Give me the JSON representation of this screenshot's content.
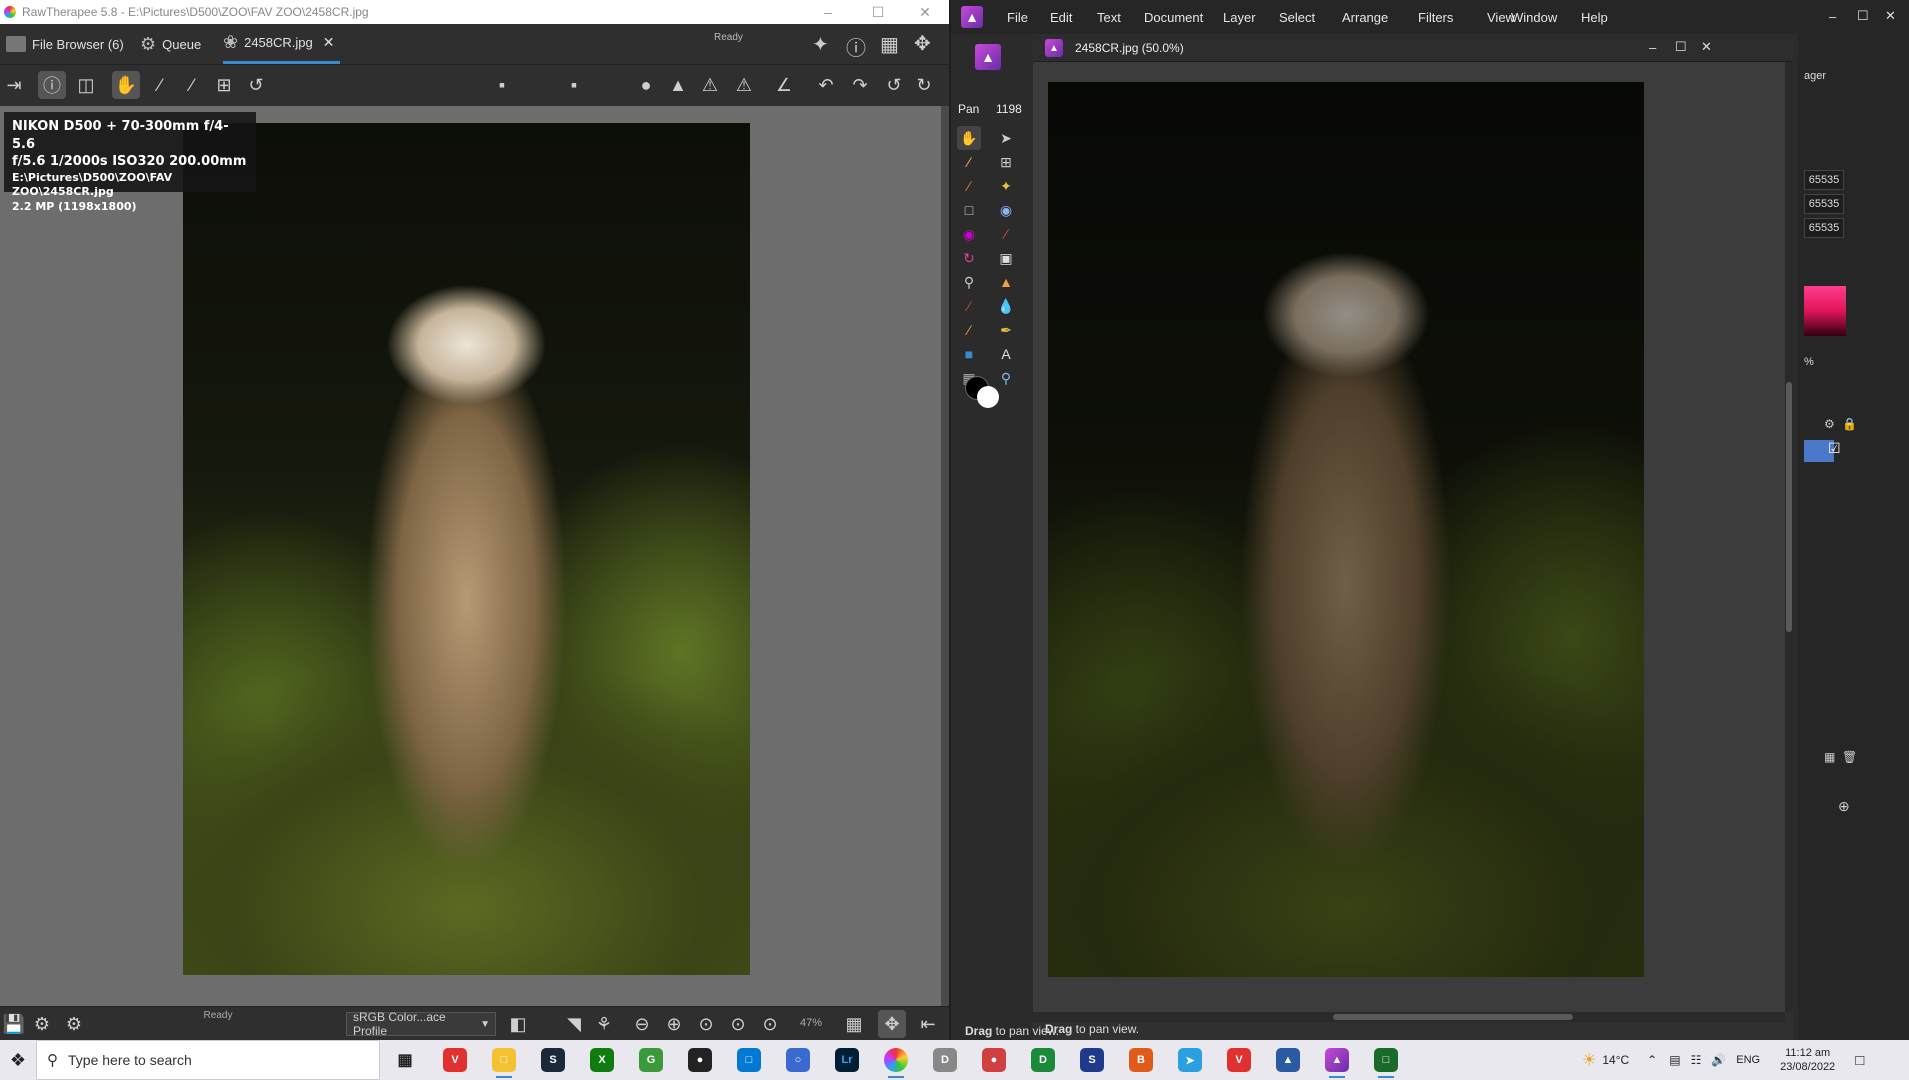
{
  "rawtherapee": {
    "window_title": "RawTherapee 5.8 - E:\\Pictures\\D500\\ZOO\\FAV ZOO\\2458CR.jpg",
    "tabs": [
      {
        "label": "File Browser (6)",
        "icon": "folder-icon"
      },
      {
        "label": "Queue",
        "icon": "gear-icon"
      },
      {
        "label": "2458CR.jpg",
        "icon": "aperture-icon"
      }
    ],
    "ready_top": "Ready",
    "info": {
      "line1": "NIKON D500 + 70-300mm f/4-5.6",
      "line2": "f/5.6  1/2000s  ISO320  200.00mm",
      "line3": "E:\\Pictures\\D500\\ZOO\\FAV ZOO\\2458CR.jpg",
      "line4": "2.2 MP (1198x1800)"
    },
    "status": {
      "ready": "Ready",
      "profile": "sRGB Color...ace Profile",
      "zoom": "47%"
    }
  },
  "affinity": {
    "menu": [
      "File",
      "Edit",
      "Text",
      "Document",
      "Layer",
      "Select",
      "Arrange",
      "Filters",
      "View",
      "Window",
      "Help"
    ],
    "context": {
      "tool": "Pan",
      "value": "1198"
    },
    "doc_title": "2458CR.jpg (50.0%)",
    "right_panel": {
      "title_fragment": "ager",
      "fields": [
        "65535",
        "65535",
        "65535"
      ],
      "percent": "%"
    },
    "hint_doc": {
      "bold": "Drag",
      "text": " to pan view."
    },
    "hint_app": {
      "bold": "Drag",
      "text": " to pan view."
    }
  },
  "taskbar": {
    "search_placeholder": "Type here to search",
    "temperature": "14°C",
    "language": "ENG",
    "time": "11:12 am",
    "date": "23/08/2022"
  }
}
